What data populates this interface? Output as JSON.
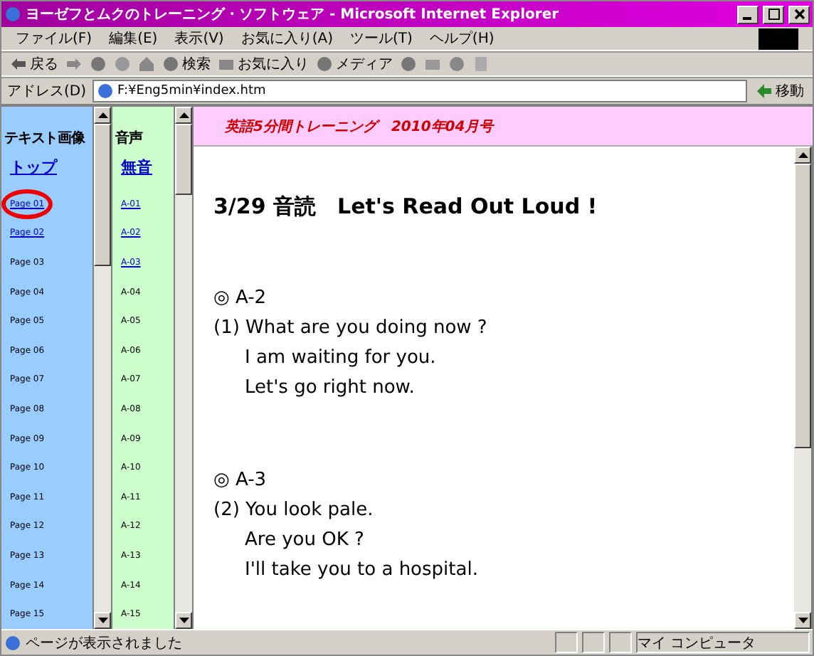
{
  "window": {
    "title": "ヨーゼフとムクのトレーニング・ソフトウェア - Microsoft Internet Explorer"
  },
  "menu": [
    "ファイル(F)",
    "編集(E)",
    "表示(V)",
    "お気に入り(A)",
    "ツール(T)",
    "ヘルプ(H)"
  ],
  "toolbar": {
    "back": "戻る",
    "search": "検索",
    "favorites": "お気に入り",
    "media": "メディア"
  },
  "address": {
    "label": "アドレス(D)",
    "value": "F:¥Eng5min¥index.htm",
    "go": "移動"
  },
  "left_frame": {
    "heading": "テキスト画像",
    "top_link": "トップ",
    "items": [
      {
        "label": "Page 01",
        "kind": "link",
        "circled": true
      },
      {
        "label": "Page 02",
        "kind": "link",
        "circled": false
      },
      {
        "label": "Page 03",
        "kind": "text",
        "circled": false
      },
      {
        "label": "Page 04",
        "kind": "text",
        "circled": false
      },
      {
        "label": "Page 05",
        "kind": "text",
        "circled": false
      },
      {
        "label": "Page 06",
        "kind": "text",
        "circled": false
      },
      {
        "label": "Page 07",
        "kind": "text",
        "circled": false
      },
      {
        "label": "Page 08",
        "kind": "text",
        "circled": false
      },
      {
        "label": "Page 09",
        "kind": "text",
        "circled": false
      },
      {
        "label": "Page 10",
        "kind": "text",
        "circled": false
      },
      {
        "label": "Page 11",
        "kind": "text",
        "circled": false
      },
      {
        "label": "Page 12",
        "kind": "text",
        "circled": false
      },
      {
        "label": "Page 13",
        "kind": "text",
        "circled": false
      },
      {
        "label": "Page 14",
        "kind": "text",
        "circled": false
      },
      {
        "label": "Page 15",
        "kind": "text",
        "circled": false
      }
    ]
  },
  "middle_frame": {
    "heading": "音声",
    "top_link": "無音",
    "items": [
      {
        "label": "A-01",
        "kind": "link"
      },
      {
        "label": "A-02",
        "kind": "link"
      },
      {
        "label": "A-03",
        "kind": "link"
      },
      {
        "label": "A-04",
        "kind": "text"
      },
      {
        "label": "A-05",
        "kind": "text"
      },
      {
        "label": "A-06",
        "kind": "text"
      },
      {
        "label": "A-07",
        "kind": "text"
      },
      {
        "label": "A-08",
        "kind": "text"
      },
      {
        "label": "A-09",
        "kind": "text"
      },
      {
        "label": "A-10",
        "kind": "text"
      },
      {
        "label": "A-11",
        "kind": "text"
      },
      {
        "label": "A-12",
        "kind": "text"
      },
      {
        "label": "A-13",
        "kind": "text"
      },
      {
        "label": "A-14",
        "kind": "text"
      },
      {
        "label": "A-15",
        "kind": "text"
      }
    ]
  },
  "banner": "英語5分間トレーニング　2010年04月号",
  "content": {
    "heading": "3/29 音読　Let's Read Out Loud !",
    "sections": [
      {
        "title": "◎ A-2",
        "question": "(1) What are you doing now ?",
        "answers": [
          "I am waiting for you.",
          "Let's go right now."
        ]
      },
      {
        "title": "◎ A-3",
        "question": "(2) You look pale.",
        "answers": [
          "Are you OK ?",
          "I'll take you to a hospital."
        ]
      }
    ]
  },
  "status_bar": {
    "message": "ページが表示されました",
    "zone": "マイ コンピュータ"
  }
}
